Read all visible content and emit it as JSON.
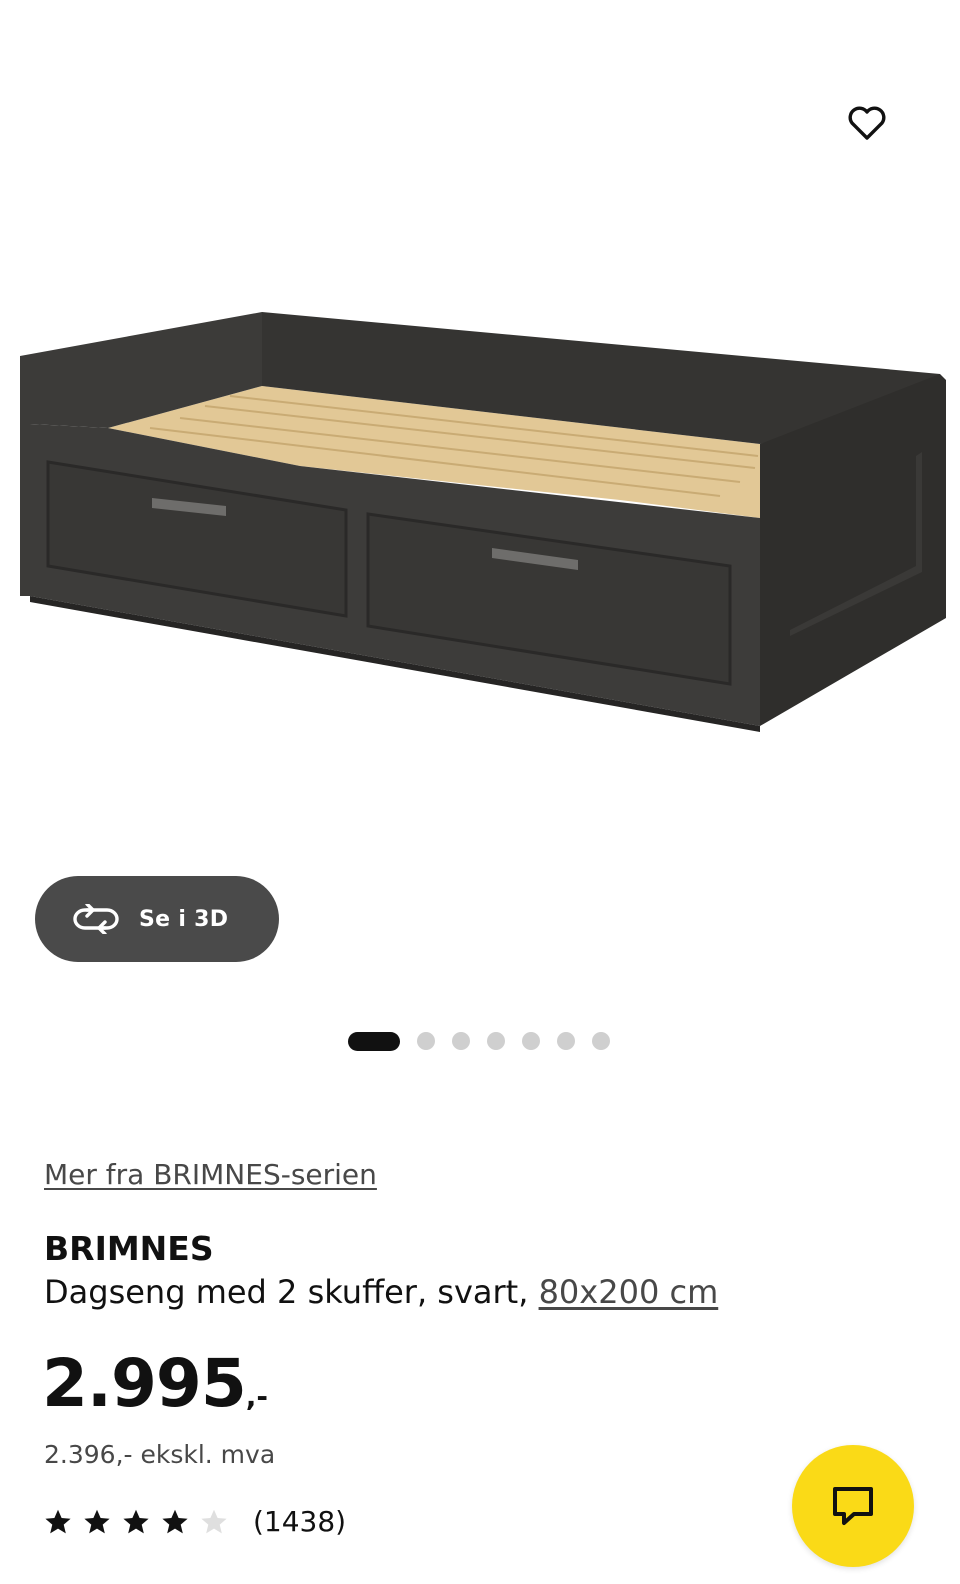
{
  "favorite": {
    "icon": "heart-outline-icon"
  },
  "view_3d": {
    "label": "Se i 3D",
    "icon": "rotate-3d-icon"
  },
  "carousel": {
    "total_images": 7,
    "active_index": 0
  },
  "series_link": {
    "label": "Mer fra BRIMNES-serien"
  },
  "product": {
    "name": "BRIMNES",
    "description": "Dagseng med 2 skuffer, svart,",
    "size_link": "80x200 cm"
  },
  "price": {
    "integer": "2.995",
    "suffix": ",-",
    "ex_vat": "2.396,- ekskl. mva"
  },
  "rating": {
    "stars": 4,
    "max_stars": 5,
    "count_label": "(1438)"
  },
  "chat": {
    "icon": "chat-bubble-icon"
  },
  "colors": {
    "chat_button": "#fada17",
    "view_3d_button": "#4a4a4a",
    "bed_frame": "#3b3a38",
    "bed_slats": "#e2c896"
  }
}
